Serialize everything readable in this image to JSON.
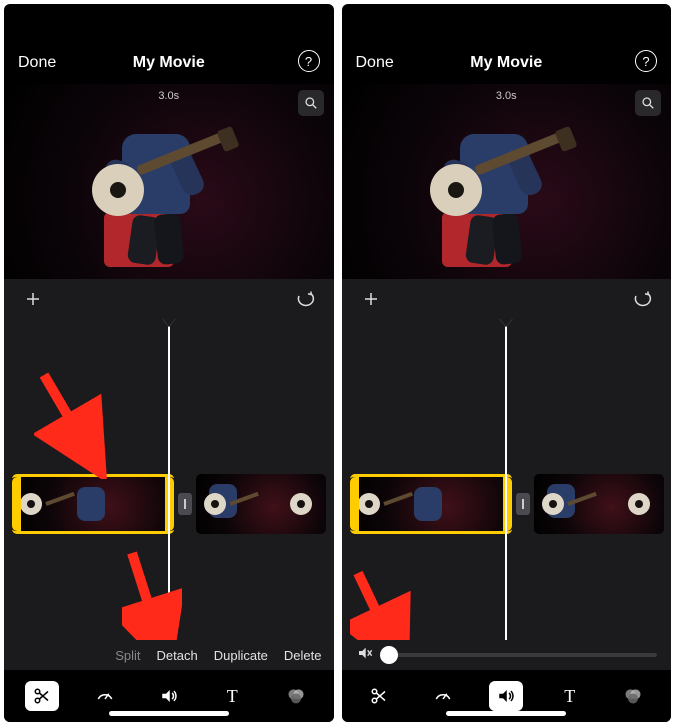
{
  "header": {
    "done": "Done",
    "title": "My Movie",
    "help_label": "?"
  },
  "preview": {
    "duration": "3.0s"
  },
  "edit_actions": {
    "split": "Split",
    "detach": "Detach",
    "duplicate": "Duplicate",
    "delete": "Delete"
  },
  "toolbar": {
    "scissors": "cut",
    "speed": "speed",
    "volume": "volume",
    "text": "T",
    "filters": "filters"
  },
  "icons": {
    "help": "help-circle",
    "zoom": "magnify",
    "add": "plus",
    "skip_back": "skip-back",
    "play": "play",
    "undo": "undo",
    "mute": "speaker-mute",
    "scissors": "scissors",
    "gauge": "gauge",
    "speaker": "speaker",
    "text": "text",
    "filter": "filter-circles"
  },
  "annotations": {
    "arrow_color": "#ff2a1a"
  }
}
